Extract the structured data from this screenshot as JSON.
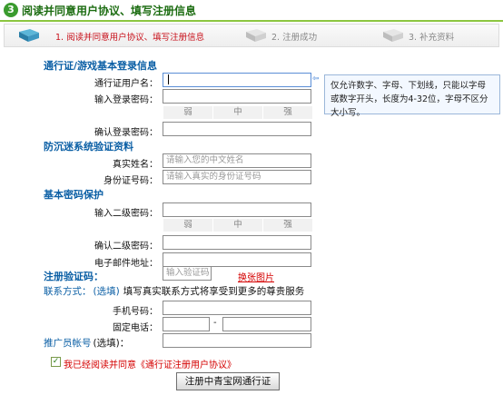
{
  "header": {
    "title": "阅读并同意用户协议、填写注册信息",
    "icon_text": "3"
  },
  "steps": [
    {
      "label": "1. 阅读并同意用户协议、填写注册信息",
      "active": true
    },
    {
      "label": "2. 注册成功",
      "active": false
    },
    {
      "label": "3. 补充资料",
      "active": false
    }
  ],
  "sections": {
    "login": "通行证/游戏基本登录信息",
    "anti": "防沉迷系统验证资料",
    "protect": "基本密码保护",
    "captcha": "注册验证码：",
    "contact_title": "联系方式：",
    "contact_optional": "(选填)",
    "contact_desc": "填写真实联系方式将享受到更多的尊贵服务",
    "promoter_title": "推广员帐号",
    "promoter_optional": "(选填)："
  },
  "fields": {
    "username_label": "通行证用户名：",
    "password_label": "输入登录密码：",
    "confirm_password_label": "确认登录密码：",
    "realname_label": "真实姓名：",
    "realname_placeholder": "请输入您的中文姓名",
    "idcard_label": "身份证号码：",
    "idcard_placeholder": "请输入真实的身份证号码",
    "password2_label": "输入二级密码：",
    "confirm_password2_label": "确认二级密码：",
    "email_label": "电子邮件地址：",
    "captcha_placeholder": "输入验证码",
    "refresh_label": "换张图片",
    "mobile_label": "手机号码：",
    "phone_label": "固定电话：",
    "phone_dash": "-"
  },
  "strength": [
    "弱",
    "中",
    "强"
  ],
  "tip": "仅允许数字、字母、下划线，只能以字母或数字开头，长度为4-32位，字母不区分大小写。",
  "agree": {
    "checked": true,
    "text": "我已经阅读并同意《通行证注册用户协议》"
  },
  "submit_label": "注册中青宝网通行证",
  "colors": {
    "header_green": "#1d6d12",
    "section_blue": "#0b5fa5",
    "link_red": "#d40000",
    "step_active": "#c8101a"
  }
}
